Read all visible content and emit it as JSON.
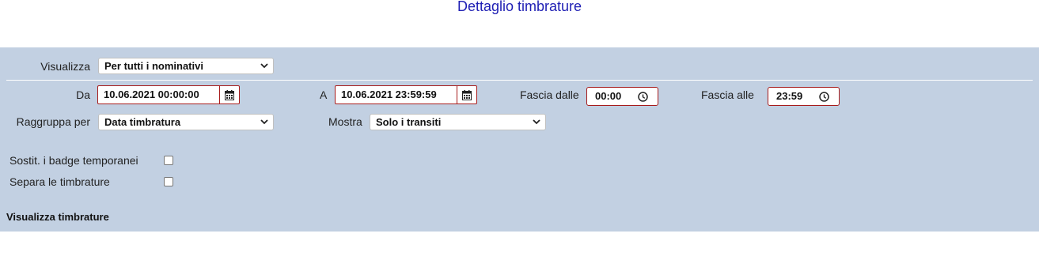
{
  "page": {
    "title": "Dettaglio timbrature"
  },
  "filters": {
    "visualizza_label": "Visualizza",
    "visualizza_value": "Per tutti i nominativi",
    "da_label": "Da",
    "da_value": "10.06.2021 00:00:00",
    "a_label": "A",
    "a_value": "10.06.2021 23:59:59",
    "fascia_dalle_label": "Fascia dalle",
    "fascia_dalle_value": "00:00",
    "fascia_alle_label": "Fascia alle",
    "fascia_alle_value": "23:59",
    "raggruppa_label": "Raggruppa per",
    "raggruppa_value": "Data timbratura",
    "mostra_label": "Mostra",
    "mostra_value": "Solo i transiti",
    "sostit_label": "Sostit. i badge temporanei",
    "sostit_checked": false,
    "separa_label": "Separa le timbrature",
    "separa_checked": false
  },
  "section": {
    "visualizza_timbrature": "Visualizza timbrature"
  },
  "icons": {
    "calendar": "calendar-icon",
    "clock": "clock-icon",
    "chevron": "chevron-down-icon"
  },
  "colors": {
    "title": "#1f1fb4",
    "panel": "#c2d0e2",
    "date_border": "#a71b1b"
  }
}
